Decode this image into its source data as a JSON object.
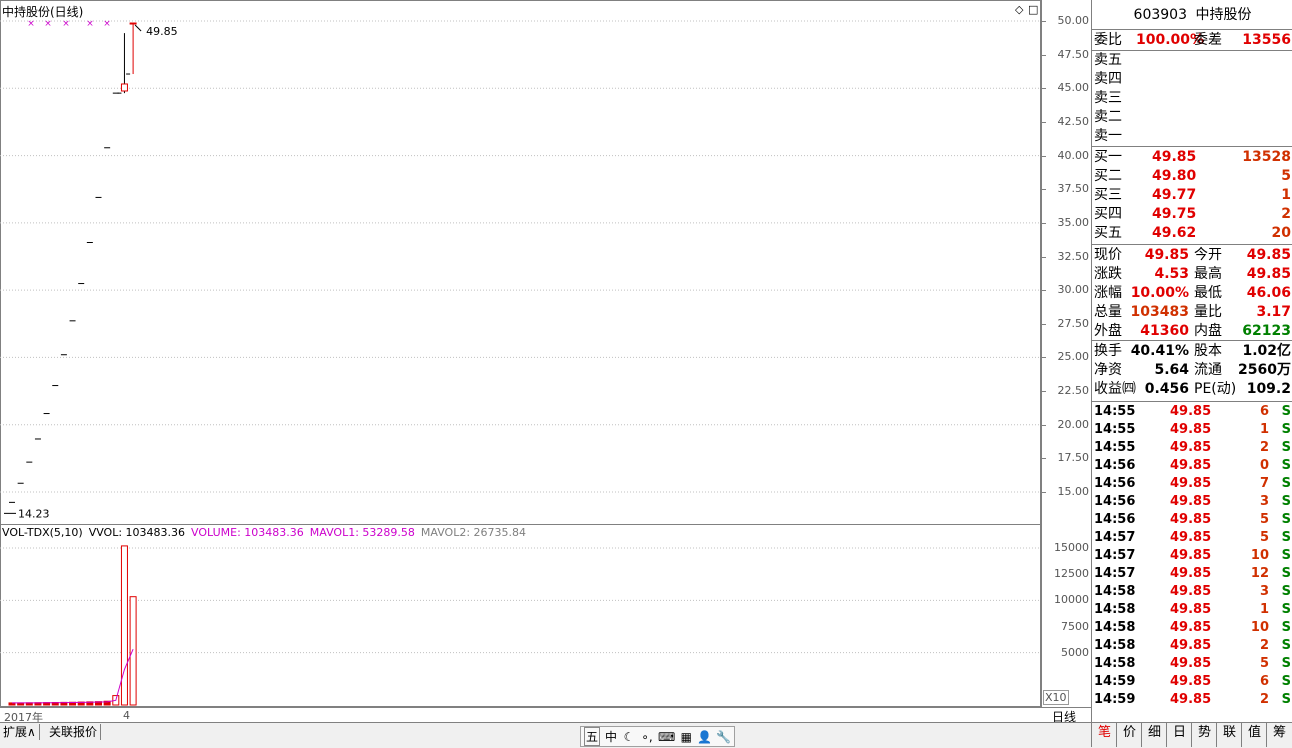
{
  "chart_title": "中持股份(日线)",
  "high_marker": "49.85",
  "low_marker": "14.23",
  "price_axis": [
    "50.00",
    "47.50",
    "45.00",
    "42.50",
    "40.00",
    "37.50",
    "35.00",
    "32.50",
    "30.00",
    "27.50",
    "25.00",
    "22.50",
    "20.00",
    "17.50",
    "15.00"
  ],
  "vol_axis": [
    "15000",
    "12500",
    "10000",
    "7500",
    "5000"
  ],
  "vol_unit": "X10",
  "x_labels": {
    "year": "2017年",
    "month": "4"
  },
  "period_label": "日线",
  "vol_legend": {
    "name": "VOL-TDX(5,10)",
    "vvol": "VVOL: 103483.36",
    "volume": "VOLUME: 103483.36",
    "mavol1": "MAVOL1: 53289.58",
    "mavol2": "MAVOL2: 26735.84"
  },
  "colors": {
    "up": "#e00000",
    "ma1": "#cc00cc",
    "ma2": "#808080",
    "grid": "#c0c0c0",
    "vvol": "#000000"
  },
  "chart_data": {
    "type": "candlestick",
    "candles": [
      {
        "o": 14.23,
        "h": 14.23,
        "l": 14.23,
        "c": 14.23
      },
      {
        "o": 15.65,
        "h": 15.65,
        "l": 15.65,
        "c": 15.65
      },
      {
        "o": 17.22,
        "h": 17.22,
        "l": 17.22,
        "c": 17.22
      },
      {
        "o": 18.94,
        "h": 18.94,
        "l": 18.94,
        "c": 18.94
      },
      {
        "o": 20.83,
        "h": 20.83,
        "l": 20.83,
        "c": 20.83
      },
      {
        "o": 22.91,
        "h": 22.91,
        "l": 22.91,
        "c": 22.91
      },
      {
        "o": 25.2,
        "h": 25.2,
        "l": 25.2,
        "c": 25.2
      },
      {
        "o": 27.72,
        "h": 27.72,
        "l": 27.72,
        "c": 27.72
      },
      {
        "o": 30.49,
        "h": 30.49,
        "l": 30.49,
        "c": 30.49
      },
      {
        "o": 33.54,
        "h": 33.54,
        "l": 33.54,
        "c": 33.54
      },
      {
        "o": 36.89,
        "h": 36.89,
        "l": 36.89,
        "c": 36.89
      },
      {
        "o": 40.58,
        "h": 40.58,
        "l": 40.58,
        "c": 40.58
      },
      {
        "o": 44.64,
        "h": 44.64,
        "l": 44.64,
        "c": 44.64
      },
      {
        "o": 45.32,
        "h": 49.1,
        "l": 44.64,
        "c": 44.8
      },
      {
        "o": 49.85,
        "h": 49.85,
        "l": 46.06,
        "c": 49.85
      }
    ],
    "volume": [
      200,
      200,
      210,
      220,
      230,
      240,
      250,
      260,
      280,
      300,
      320,
      360,
      900,
      15200,
      10348
    ],
    "mavol1": [
      200,
      200,
      203,
      208,
      212,
      220,
      230,
      240,
      252,
      266,
      282,
      304,
      444,
      3402,
      5329
    ]
  },
  "quote": {
    "code": "603903",
    "name": "中持股份",
    "weibi_label": "委比",
    "weibi": "100.00%",
    "weicha_label": "委差",
    "weicha": "13556",
    "sell": [
      {
        "label": "卖五",
        "price": "",
        "vol": ""
      },
      {
        "label": "卖四",
        "price": "",
        "vol": ""
      },
      {
        "label": "卖三",
        "price": "",
        "vol": ""
      },
      {
        "label": "卖二",
        "price": "",
        "vol": ""
      },
      {
        "label": "卖一",
        "price": "",
        "vol": ""
      }
    ],
    "buy": [
      {
        "label": "买一",
        "price": "49.85",
        "vol": "13528"
      },
      {
        "label": "买二",
        "price": "49.80",
        "vol": "5"
      },
      {
        "label": "买三",
        "price": "49.77",
        "vol": "1"
      },
      {
        "label": "买四",
        "price": "49.75",
        "vol": "2"
      },
      {
        "label": "买五",
        "price": "49.62",
        "vol": "20"
      }
    ],
    "stats1": [
      {
        "l1": "现价",
        "v1": "49.85",
        "l2": "今开",
        "v2": "49.85"
      },
      {
        "l1": "涨跌",
        "v1": "4.53",
        "l2": "最高",
        "v2": "49.85"
      },
      {
        "l1": "涨幅",
        "v1": "10.00%",
        "l2": "最低",
        "v2": "46.06"
      },
      {
        "l1": "总量",
        "v1": "103483",
        "l2": "量比",
        "v2": "3.17"
      },
      {
        "l1": "外盘",
        "v1": "41360",
        "l2": "内盘",
        "v2": "62123"
      }
    ],
    "stats2": [
      {
        "l1": "换手",
        "v1": "40.41%",
        "l2": "股本",
        "v2": "1.02亿"
      },
      {
        "l1": "净资",
        "v1": "5.64",
        "l2": "流通",
        "v2": "2560万"
      },
      {
        "l1": "收益㈣",
        "v1": "0.456",
        "l2": "PE(动)",
        "v2": "109.2"
      }
    ]
  },
  "ticks": [
    {
      "t": "14:55",
      "p": "49.85",
      "v": "6",
      "s": "S"
    },
    {
      "t": "14:55",
      "p": "49.85",
      "v": "1",
      "s": "S"
    },
    {
      "t": "14:55",
      "p": "49.85",
      "v": "2",
      "s": "S"
    },
    {
      "t": "14:56",
      "p": "49.85",
      "v": "0",
      "s": "S"
    },
    {
      "t": "14:56",
      "p": "49.85",
      "v": "7",
      "s": "S"
    },
    {
      "t": "14:56",
      "p": "49.85",
      "v": "3",
      "s": "S"
    },
    {
      "t": "14:56",
      "p": "49.85",
      "v": "5",
      "s": "S"
    },
    {
      "t": "14:57",
      "p": "49.85",
      "v": "5",
      "s": "S"
    },
    {
      "t": "14:57",
      "p": "49.85",
      "v": "10",
      "s": "S"
    },
    {
      "t": "14:57",
      "p": "49.85",
      "v": "12",
      "s": "S"
    },
    {
      "t": "14:58",
      "p": "49.85",
      "v": "3",
      "s": "S"
    },
    {
      "t": "14:58",
      "p": "49.85",
      "v": "1",
      "s": "S"
    },
    {
      "t": "14:58",
      "p": "49.85",
      "v": "10",
      "s": "S"
    },
    {
      "t": "14:58",
      "p": "49.85",
      "v": "2",
      "s": "S"
    },
    {
      "t": "14:58",
      "p": "49.85",
      "v": "5",
      "s": "S"
    },
    {
      "t": "14:59",
      "p": "49.85",
      "v": "6",
      "s": "S"
    },
    {
      "t": "14:59",
      "p": "49.85",
      "v": "2",
      "s": "S"
    }
  ],
  "bottom_tabs": [
    "扩展∧",
    "关联报价"
  ],
  "toolbar": [
    "五",
    "中",
    "☾",
    "∘,",
    "⌨",
    "▦",
    "👤",
    "🔧"
  ],
  "right_tabs": [
    "笔",
    "价",
    "细",
    "日",
    "势",
    "联",
    "值",
    "筹"
  ]
}
